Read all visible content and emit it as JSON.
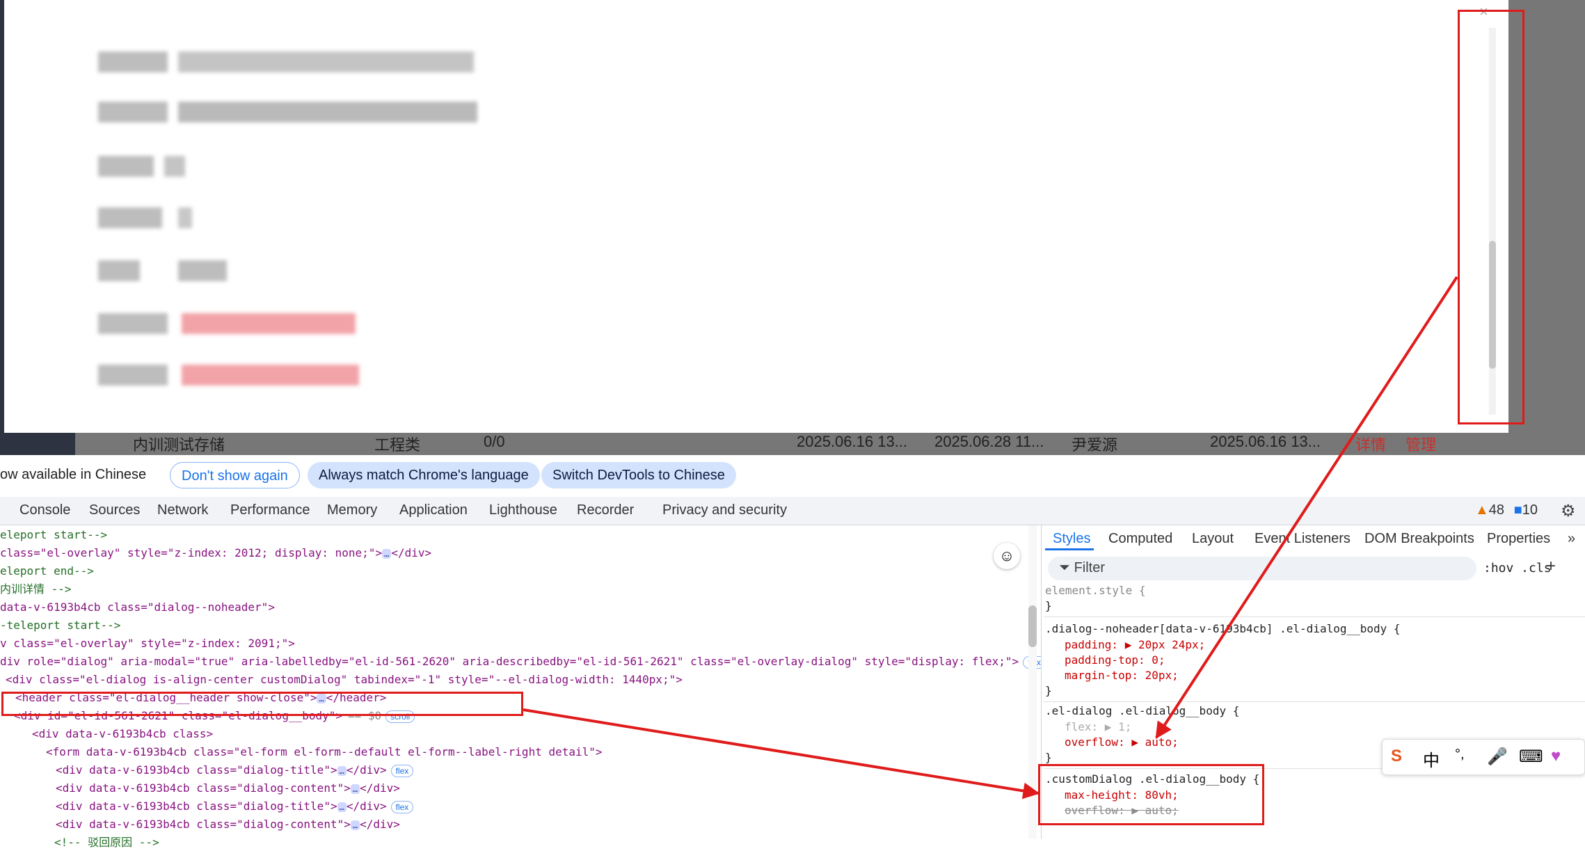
{
  "page": {
    "table_row": {
      "name": "内训测试存储",
      "category": "工程类",
      "count": "0/0",
      "date1": "2025.06.16 13...",
      "date2": "2025.06.28 11...",
      "person": "尹爱源",
      "date3": "2025.06.16 13...",
      "detail_link": "详情",
      "manage_link": "管理"
    },
    "dialog": {
      "close_icon": "×"
    }
  },
  "infobar": {
    "message": "ow available in Chinese",
    "dont_show": "Don't show again",
    "always_match": "Always match Chrome's language",
    "switch": "Switch DevTools to Chinese"
  },
  "devtools_tabs": [
    "Console",
    "Sources",
    "Network",
    "Performance",
    "Memory",
    "Application",
    "Lighthouse",
    "Recorder",
    "Privacy and security"
  ],
  "issues": {
    "warnings": "48",
    "messages": "10"
  },
  "elements": [
    {
      "text": "eleport start-->",
      "kind": "comment"
    },
    {
      "text": "class=\"el-overlay\" style=\"z-index: 2012; display: none;\">",
      "kind": "tag",
      "suffix": "</div>"
    },
    {
      "text": "eleport end-->",
      "kind": "comment"
    },
    {
      "text": "内训详情 -->",
      "kind": "comment"
    },
    {
      "text": "data-v-6193b4cb class=\"dialog--noheader\">",
      "kind": "tag"
    },
    {
      "text": "-teleport start-->",
      "kind": "comment"
    },
    {
      "text": "v class=\"el-overlay\" style=\"z-index: 2091;\">",
      "kind": "tag"
    },
    {
      "text": "div role=\"dialog\" aria-modal=\"true\" aria-labelledby=\"el-id-561-2620\" aria-describedby=\"el-id-561-2621\" class=\"el-overlay-dialog\" style=\"display: flex;\">",
      "kind": "tag",
      "badge": "flex"
    },
    {
      "text": "<div class=\"el-dialog is-align-center customDialog\" tabindex=\"-1\" style=\"--el-dialog-width: 1440px;\">",
      "kind": "tag"
    },
    {
      "text": "<header class=\"el-dialog__header show-close\">",
      "kind": "tag",
      "suffix": "</header>"
    },
    {
      "text": "<div id=\"el-id-561-2621\" class=\"el-dialog__body\">",
      "kind": "tag",
      "badge": "scroll",
      "suffix": "== $0"
    },
    {
      "text": "<div data-v-6193b4cb class>",
      "kind": "tag"
    },
    {
      "text": "<form data-v-6193b4cb class=\"el-form el-form--default el-form--label-right detail\">",
      "kind": "tag"
    },
    {
      "text": "<div data-v-6193b4cb class=\"dialog-title\">",
      "kind": "tag",
      "suffix": "</div>",
      "badge": "flex"
    },
    {
      "text": "<div data-v-6193b4cb class=\"dialog-content\">",
      "kind": "tag",
      "suffix": "</div>"
    },
    {
      "text": "<div data-v-6193b4cb class=\"dialog-title\">",
      "kind": "tag",
      "suffix": "</div>",
      "badge": "flex"
    },
    {
      "text": "<div data-v-6193b4cb class=\"dialog-content\">",
      "kind": "tag",
      "suffix": "</div>"
    },
    {
      "text": "<!-- 驳回原因 -->",
      "kind": "comment"
    }
  ],
  "styles_tabs": [
    "Styles",
    "Computed",
    "Layout",
    "Event Listeners",
    "DOM Breakpoints",
    "Properties"
  ],
  "styles": {
    "filter_placeholder": "Filter",
    "hov": ":hov .cls",
    "rules": {
      "r0_sel": "element.style {",
      "r0_close": "}",
      "r1_sel": ".dialog--noheader[data-v-6193b4cb] .el-dialog__body {",
      "r1_p1": "padding: ▶ 20px 24px;",
      "r1_p2": "padding-top: 0;",
      "r1_p3": "margin-top: 20px;",
      "r1_close": "}",
      "r2_sel": ".el-dialog .el-dialog__body {",
      "r2_p1": "flex: ▶ 1;",
      "r2_p2": "overflow: ▶ auto;",
      "r2_close": "}",
      "r3_sel": ".customDialog .el-dialog__body {",
      "r3_p1": "max-height: 80vh;",
      "r3_p2": "overflow: ▶ auto;"
    }
  },
  "ime": {
    "lang": "中",
    "punct": "°,"
  },
  "colors": {
    "highlight": "#e01b1b",
    "accent": "#1a73e8"
  }
}
